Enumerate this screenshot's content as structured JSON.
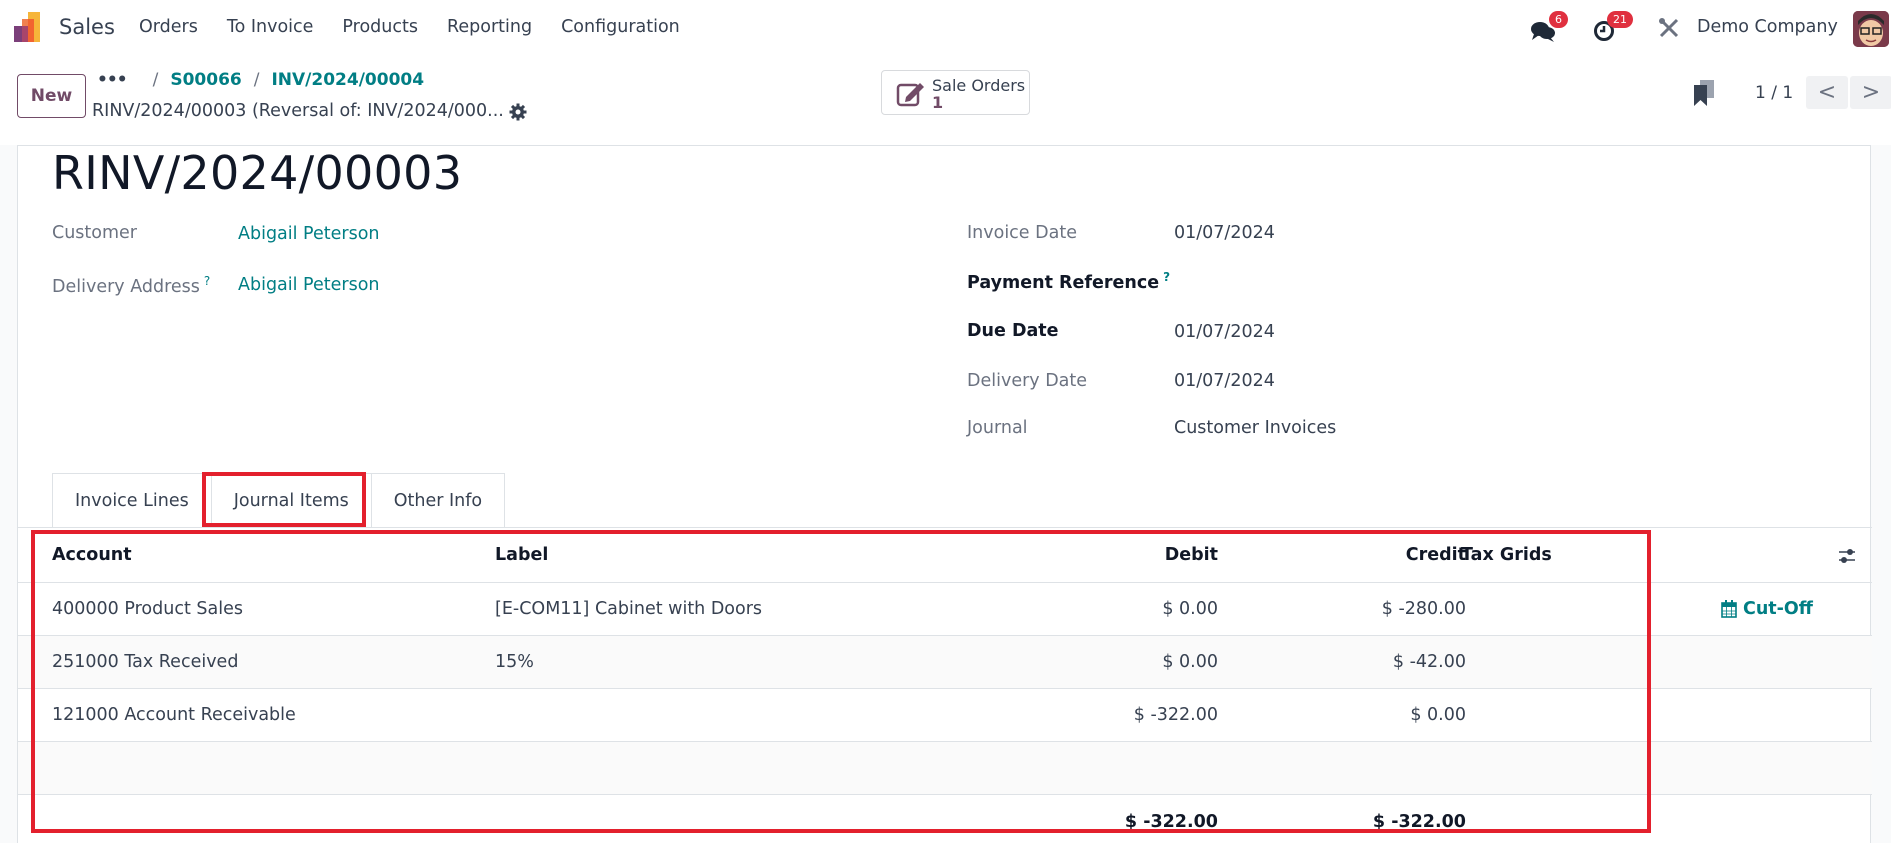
{
  "topnav": {
    "app_name": "Sales",
    "menu": [
      "Orders",
      "To Invoice",
      "Products",
      "Reporting",
      "Configuration"
    ],
    "messages_badge": "6",
    "activities_badge": "21",
    "company": "Demo Company"
  },
  "control_panel": {
    "new_label": "New",
    "breadcrumb": {
      "ellipsis": "...",
      "items": [
        "S00066",
        "INV/2024/00004"
      ],
      "separator": "/"
    },
    "record_name": "RINV/2024/00003 (Reversal of: INV/2024/000...",
    "smart_button": {
      "label": "Sale Orders",
      "count": "1"
    },
    "pager": {
      "text": "1 / 1",
      "prev": "<",
      "next": ">"
    }
  },
  "form": {
    "title": "RINV/2024/00003",
    "left_fields": [
      {
        "label": "Customer",
        "value": "Abigail Peterson",
        "help": ""
      },
      {
        "label": "Delivery Address",
        "value": "Abigail Peterson",
        "help": "?"
      }
    ],
    "right_fields": [
      {
        "label": "Invoice Date",
        "value": "01/07/2024"
      },
      {
        "label": "Payment Reference",
        "value": "",
        "help": "?"
      },
      {
        "label": "Due Date",
        "value": "01/07/2024"
      },
      {
        "label": "Delivery Date",
        "value": "01/07/2024"
      },
      {
        "label": "Journal",
        "value": "Customer Invoices"
      }
    ],
    "tabs": [
      "Invoice Lines",
      "Journal Items",
      "Other Info"
    ],
    "active_tab": "Journal Items"
  },
  "journal_items": {
    "columns": {
      "account": "Account",
      "label": "Label",
      "debit": "Debit",
      "credit": "Credit",
      "tax_grids": "Tax Grids"
    },
    "rows": [
      {
        "account": "400000 Product Sales",
        "label": "[E-COM11] Cabinet with Doors",
        "debit": "$ 0.00",
        "credit": "$ -280.00",
        "tax_grids": "",
        "action": "Cut-Off"
      },
      {
        "account": "251000 Tax Received",
        "label": "15%",
        "debit": "$ 0.00",
        "credit": "$ -42.00",
        "tax_grids": ""
      },
      {
        "account": "121000 Account Receivable",
        "label": "",
        "debit": "$ -322.00",
        "credit": "$ 0.00",
        "tax_grids": ""
      }
    ],
    "totals": {
      "debit": "$ -322.00",
      "credit": "$ -322.00"
    }
  },
  "colors": {
    "brand": "#714b67",
    "link": "#017e84",
    "badge": "#e0303f",
    "highlight": "#e3202d"
  }
}
